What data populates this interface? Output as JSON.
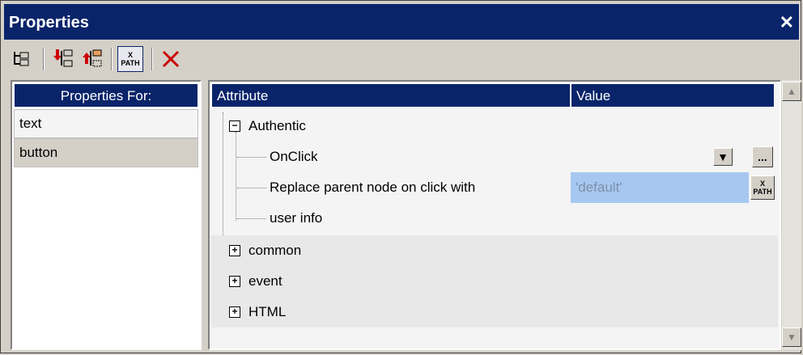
{
  "window": {
    "title": "Properties",
    "close_label": "✕"
  },
  "toolbar": {
    "items": [
      {
        "name": "tree-view-icon"
      },
      {
        "name": "insert-before-icon"
      },
      {
        "name": "insert-after-icon"
      },
      {
        "name": "xpath-icon",
        "label_top": "X",
        "label_bottom": "PATH"
      },
      {
        "name": "delete-icon"
      }
    ]
  },
  "left_panel": {
    "header": "Properties For:",
    "items": [
      "text",
      "button"
    ],
    "selected": "button"
  },
  "grid": {
    "col_attribute": "Attribute",
    "col_value": "Value",
    "groups": [
      {
        "label": "Authentic",
        "expanded": true
      },
      {
        "label": "common",
        "expanded": false
      },
      {
        "label": "event",
        "expanded": false
      },
      {
        "label": "HTML",
        "expanded": false
      }
    ],
    "authentic_rows": [
      {
        "label": "OnClick",
        "value": ""
      },
      {
        "label": "Replace parent node on click with",
        "value": "'default'"
      },
      {
        "label": "user info",
        "value": ""
      }
    ],
    "more_label": "...",
    "xpath_btn": {
      "top": "X",
      "bottom": "PATH"
    },
    "expanded_sign": "−",
    "collapsed_sign": "+"
  },
  "colors": {
    "header_blue": "#0a246a",
    "highlight": "#a6c8f0",
    "face": "#d4d0c8"
  }
}
